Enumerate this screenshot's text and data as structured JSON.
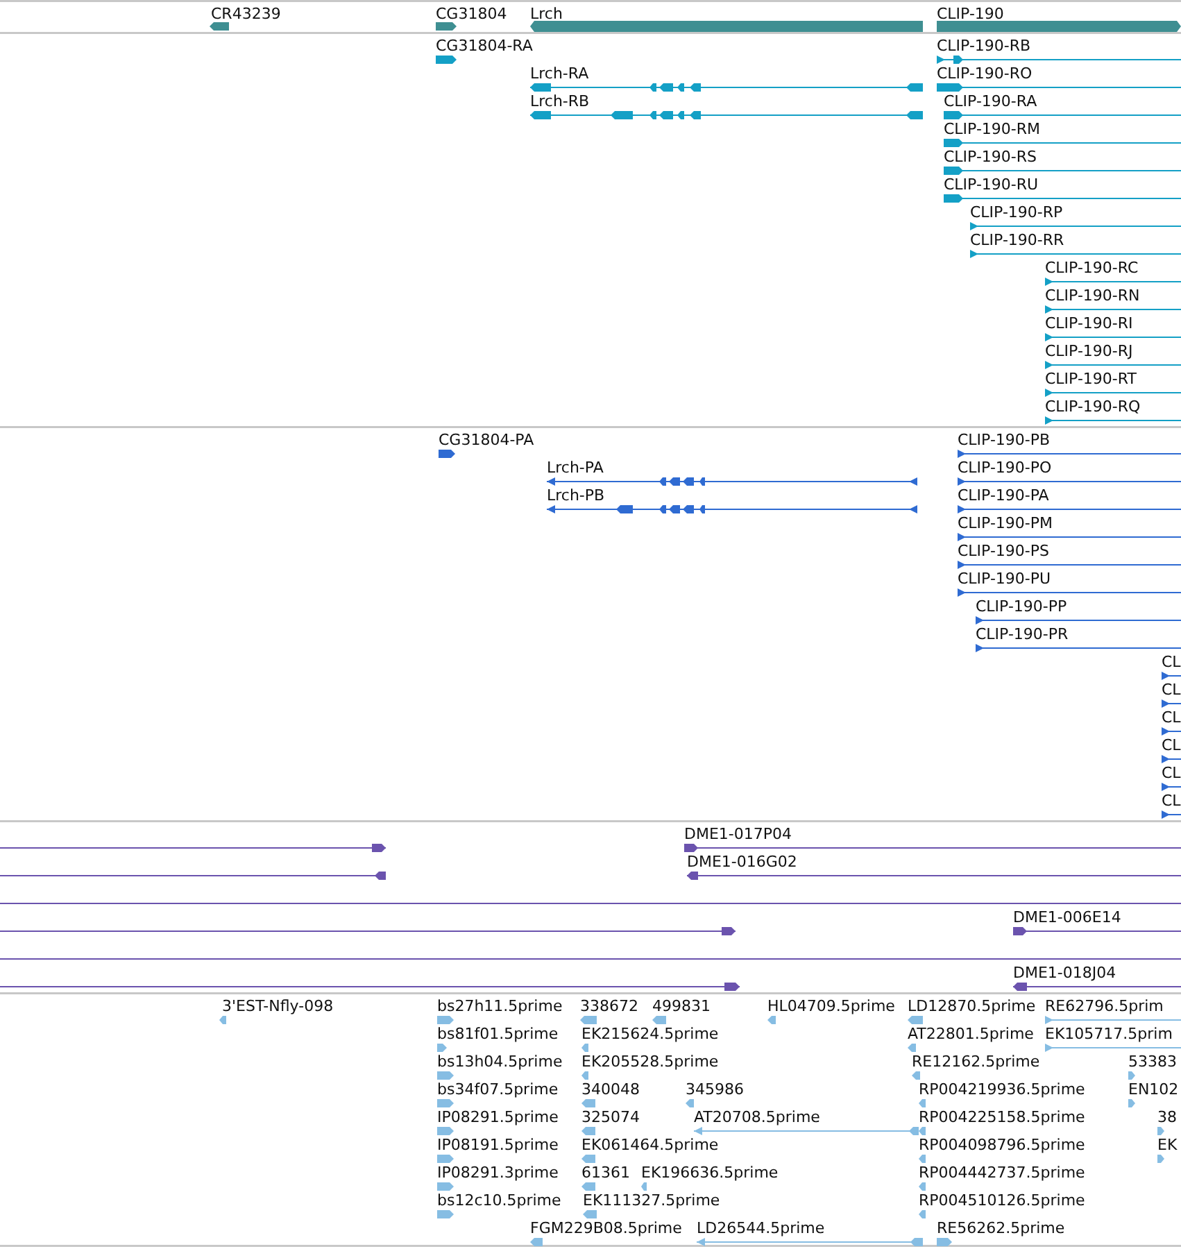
{
  "tracks": [
    {
      "kind": "gene",
      "features": [
        {
          "label": "CR43239",
          "kind": "block",
          "reverse": true
        },
        {
          "label": "CG31804",
          "kind": "block",
          "reverse": false
        },
        {
          "label": "Lrch",
          "kind": "bar",
          "reverse": true
        },
        {
          "label": "CLIP-190",
          "kind": "bar",
          "reverse": false
        }
      ]
    },
    {
      "kind": "transcript",
      "features": [
        {
          "label": "CG31804-RA",
          "kind": "block",
          "reverse": false
        },
        {
          "label": "Lrch-RA",
          "kind": "line",
          "reverse": true
        },
        {
          "label": "Lrch-RB",
          "kind": "line",
          "reverse": true
        },
        {
          "label": "CLIP-190-RB",
          "kind": "line",
          "reverse": false
        },
        {
          "label": "CLIP-190-RO",
          "kind": "line",
          "reverse": false
        },
        {
          "label": "CLIP-190-RA",
          "kind": "line",
          "reverse": false
        },
        {
          "label": "CLIP-190-RM",
          "kind": "line",
          "reverse": false
        },
        {
          "label": "CLIP-190-RS",
          "kind": "line",
          "reverse": false
        },
        {
          "label": "CLIP-190-RU",
          "kind": "line",
          "reverse": false
        },
        {
          "label": "CLIP-190-RP",
          "kind": "line",
          "reverse": false
        },
        {
          "label": "CLIP-190-RR",
          "kind": "line",
          "reverse": false
        },
        {
          "label": "CLIP-190-RC",
          "kind": "line",
          "reverse": false
        },
        {
          "label": "CLIP-190-RN",
          "kind": "line",
          "reverse": false
        },
        {
          "label": "CLIP-190-RI",
          "kind": "line",
          "reverse": false
        },
        {
          "label": "CLIP-190-RJ",
          "kind": "line",
          "reverse": false
        },
        {
          "label": "CLIP-190-RT",
          "kind": "line",
          "reverse": false
        },
        {
          "label": "CLIP-190-RQ",
          "kind": "line",
          "reverse": false
        }
      ]
    },
    {
      "kind": "protein",
      "features": [
        {
          "label": "CG31804-PA",
          "kind": "block",
          "reverse": false
        },
        {
          "label": "Lrch-PA",
          "kind": "line",
          "reverse": true
        },
        {
          "label": "Lrch-PB",
          "kind": "line",
          "reverse": true
        },
        {
          "label": "CLIP-190-PB",
          "kind": "line",
          "reverse": false
        },
        {
          "label": "CLIP-190-PO",
          "kind": "line",
          "reverse": false
        },
        {
          "label": "CLIP-190-PA",
          "kind": "line",
          "reverse": false
        },
        {
          "label": "CLIP-190-PM",
          "kind": "line",
          "reverse": false
        },
        {
          "label": "CLIP-190-PS",
          "kind": "line",
          "reverse": false
        },
        {
          "label": "CLIP-190-PU",
          "kind": "line",
          "reverse": false
        },
        {
          "label": "CLIP-190-PP",
          "kind": "line",
          "reverse": false
        },
        {
          "label": "CLIP-190-PR",
          "kind": "line",
          "reverse": false
        },
        {
          "label": "CL",
          "kind": "line",
          "reverse": false
        },
        {
          "label": "CL",
          "kind": "line",
          "reverse": false
        },
        {
          "label": "CL",
          "kind": "line",
          "reverse": false
        },
        {
          "label": "CL",
          "kind": "line",
          "reverse": false
        },
        {
          "label": "CL",
          "kind": "line",
          "reverse": false
        },
        {
          "label": "CL",
          "kind": "line",
          "reverse": false
        }
      ]
    },
    {
      "kind": "clone",
      "features": [
        {
          "kind": "line",
          "reverse": false
        },
        {
          "label": "DME1-017P04",
          "kind": "line",
          "reverse": false
        },
        {
          "kind": "line",
          "reverse": true
        },
        {
          "label": "DME1-016G02",
          "kind": "line",
          "reverse": true
        },
        {
          "kind": "line"
        },
        {
          "kind": "line",
          "reverse": false
        },
        {
          "label": "DME1-006E14",
          "kind": "line",
          "reverse": false
        },
        {
          "kind": "line"
        },
        {
          "kind": "line",
          "reverse": false
        },
        {
          "label": "DME1-018J04",
          "kind": "line",
          "reverse": true
        }
      ]
    },
    {
      "kind": "est",
      "features": [
        {
          "label": "3'EST-Nfly-098",
          "kind": "block",
          "reverse": true
        },
        {
          "label": "bs27h11.5prime",
          "kind": "block",
          "reverse": false
        },
        {
          "label": "338672",
          "kind": "block",
          "reverse": true
        },
        {
          "label": "499831",
          "kind": "block",
          "reverse": true
        },
        {
          "label": "HL04709.5prime",
          "kind": "block",
          "reverse": true
        },
        {
          "label": "LD12870.5prime",
          "kind": "block",
          "reverse": true
        },
        {
          "label": "RE62796.5prim",
          "kind": "line",
          "reverse": false
        },
        {
          "label": "bs81f01.5prime",
          "kind": "block",
          "reverse": false
        },
        {
          "label": "EK215624.5prime",
          "kind": "block",
          "reverse": true
        },
        {
          "label": "AT22801.5prime",
          "kind": "block",
          "reverse": true
        },
        {
          "label": "EK105717.5prim",
          "kind": "line",
          "reverse": false
        },
        {
          "label": "bs13h04.5prime",
          "kind": "block",
          "reverse": false
        },
        {
          "label": "EK205528.5prime",
          "kind": "block",
          "reverse": true
        },
        {
          "label": "RE12162.5prime",
          "kind": "block",
          "reverse": true
        },
        {
          "label": "53383",
          "kind": "block",
          "reverse": false
        },
        {
          "label": "bs34f07.5prime",
          "kind": "block",
          "reverse": false
        },
        {
          "label": "340048",
          "kind": "block",
          "reverse": true
        },
        {
          "label": "345986",
          "kind": "block",
          "reverse": true
        },
        {
          "label": "RP004219936.5prime",
          "kind": "block",
          "reverse": true
        },
        {
          "label": "EN102",
          "kind": "block",
          "reverse": false
        },
        {
          "label": "IP08291.5prime",
          "kind": "block",
          "reverse": false
        },
        {
          "label": "325074",
          "kind": "block",
          "reverse": true
        },
        {
          "label": "AT20708.5prime",
          "kind": "line",
          "reverse": true
        },
        {
          "label": "RP004225158.5prime",
          "kind": "block",
          "reverse": true
        },
        {
          "label": "38",
          "kind": "block",
          "reverse": false
        },
        {
          "label": "IP08191.5prime",
          "kind": "block",
          "reverse": false
        },
        {
          "label": "EK061464.5prime",
          "kind": "block",
          "reverse": true
        },
        {
          "label": "RP004098796.5prime",
          "kind": "block",
          "reverse": true
        },
        {
          "label": "EK",
          "kind": "block",
          "reverse": false
        },
        {
          "label": "IP08291.3prime",
          "kind": "block",
          "reverse": false
        },
        {
          "label": "61361",
          "kind": "block",
          "reverse": true
        },
        {
          "label": "EK196636.5prime",
          "kind": "block",
          "reverse": true
        },
        {
          "label": "RP004442737.5prime",
          "kind": "block",
          "reverse": true
        },
        {
          "label": "bs12c10.5prime",
          "kind": "block",
          "reverse": false
        },
        {
          "label": "EK111327.5prime",
          "kind": "block",
          "reverse": true
        },
        {
          "label": "RP004510126.5prime",
          "kind": "block",
          "reverse": true
        },
        {
          "label": "FGM229B08.5prime",
          "kind": "block",
          "reverse": true
        },
        {
          "label": "LD26544.5prime",
          "kind": "line",
          "reverse": true
        },
        {
          "label": "RE56262.5prime",
          "kind": "block",
          "reverse": false
        }
      ]
    }
  ]
}
